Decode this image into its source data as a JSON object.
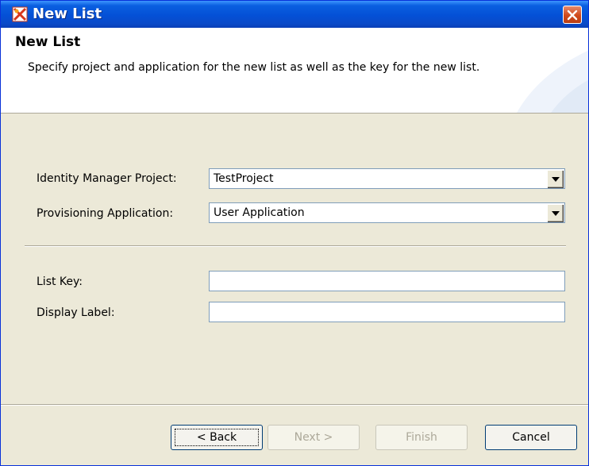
{
  "window": {
    "title": "New List"
  },
  "header": {
    "title": "New List",
    "description": "Specify project and application for the new list as well as the key for the new list."
  },
  "form": {
    "project_label": "Identity Manager Project:",
    "project_value": "TestProject",
    "application_label": "Provisioning Application:",
    "application_value": "User Application",
    "list_key_label": "List Key:",
    "list_key_value": "",
    "display_label_label": "Display Label:",
    "display_label_value": ""
  },
  "buttons": {
    "back": "< Back",
    "next": "Next >",
    "finish": "Finish",
    "cancel": "Cancel"
  },
  "icons": {
    "app": "new-list-app-icon",
    "close": "close-icon",
    "dropdown": "chevron-down-icon"
  },
  "colors": {
    "titlebar": "#0450d6",
    "close": "#d0491b",
    "dialog_bg": "#ece9d8",
    "disabled_text": "#aca899"
  }
}
